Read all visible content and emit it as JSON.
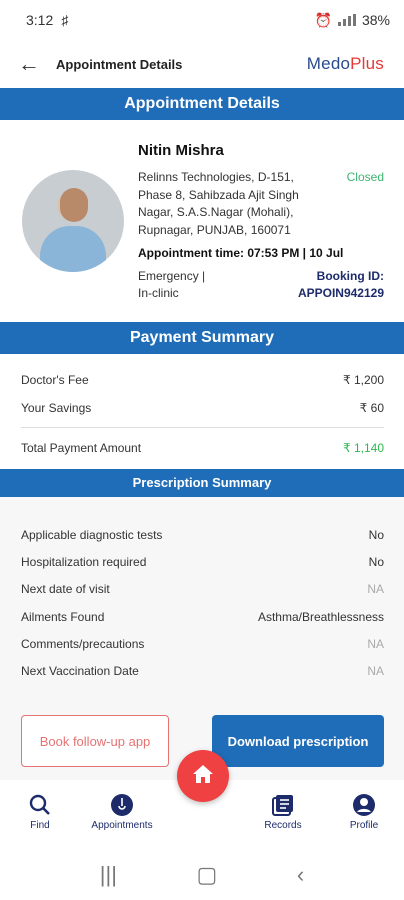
{
  "status_bar": {
    "time": "3:12",
    "battery": "38%"
  },
  "header": {
    "title": "Appointment Details",
    "brand_a": "Medo",
    "brand_b": "Plus"
  },
  "appointment": {
    "banner": "Appointment Details",
    "doctor_name": "Nitin Mishra",
    "status": "Closed",
    "address": "Relinns Technologies, D-151, Phase 8, Sahibzada Ajit Singh Nagar, S.A.S.Nagar (Mohali), Rupnagar, PUNJAB, 160071",
    "time_label": "Appointment time: 07:53 PM | 10 Jul",
    "type_line1": "Emergency |",
    "type_line2": "In-clinic",
    "booking_label": "Booking ID:",
    "booking_id": "APPOIN942129"
  },
  "payment": {
    "banner": "Payment Summary",
    "rows": [
      {
        "label": "Doctor's Fee",
        "value": "₹ 1,200"
      },
      {
        "label": "Your Savings",
        "value": "₹ 60"
      }
    ],
    "total_label": "Total Payment Amount",
    "total_value": "₹ 1,140"
  },
  "prescription": {
    "banner": "Prescription Summary",
    "rows": [
      {
        "label": "Applicable diagnostic tests",
        "value": "No"
      },
      {
        "label": "Hospitalization required",
        "value": "No"
      },
      {
        "label": "Next date of visit",
        "value": "NA"
      },
      {
        "label": "Ailments Found",
        "value": "Asthma/Breathlessness"
      },
      {
        "label": "Comments/precautions",
        "value": "NA"
      },
      {
        "label": "Next Vaccination Date",
        "value": "NA"
      }
    ]
  },
  "actions": {
    "followup": "Book follow-up app",
    "download": "Download prescription"
  },
  "bottom_nav": {
    "find": "Find",
    "appointments": "Appointments",
    "records": "Records",
    "profile": "Profile"
  },
  "colors": {
    "primary": "#1f6db8",
    "accent": "#ef4141",
    "success": "#2eb84e"
  }
}
